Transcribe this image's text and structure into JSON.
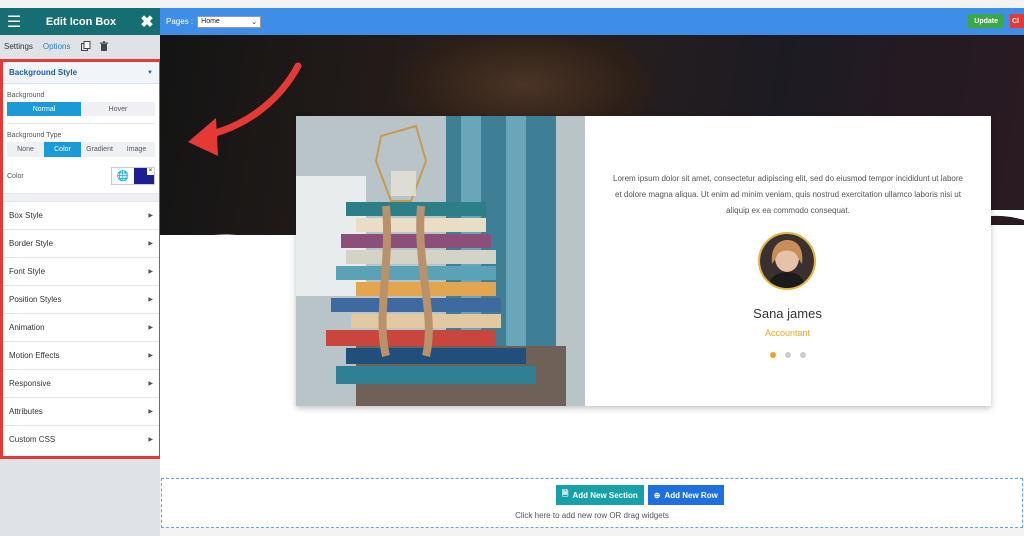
{
  "sidebar": {
    "title": "Edit Icon Box",
    "tabs": {
      "settings": "Settings",
      "options": "Options"
    },
    "section_title": "Background Style",
    "background_label": "Background",
    "state_tabs": [
      "Normal",
      "Hover"
    ],
    "type_label": "Background Type",
    "type_tabs": [
      "None",
      "Color",
      "Gradient",
      "Image"
    ],
    "color_label": "Color",
    "color_value": "#1b1f8f",
    "accordion": [
      "Box Style",
      "Border Style",
      "Font Style",
      "Position Styles",
      "Animation",
      "Motion Effects",
      "Responsive",
      "Attributes",
      "Custom CSS"
    ]
  },
  "topbar": {
    "pages_label": "Pages :",
    "page_select": "Home",
    "update": "Update",
    "red_btn": "Cl"
  },
  "card": {
    "text": "Lorem ipsum dolor sit amet, consectetur adipiscing elit, sed do eiusmod tempor incididunt ut labore et dolore magna aliqua. Ut enim ad minim veniam, quis nostrud exercitation ullamco laboris nisi ut aliquip ex ea commodo consequat.",
    "name": "Sana james",
    "role": "Accountant"
  },
  "add": {
    "section": "Add New Section",
    "row": "Add New Row",
    "hint": "Click here to add new row OR drag widgets"
  },
  "colors": {
    "accent": "#1a9ad6",
    "header": "#166e72",
    "topbar": "#3e8ee8",
    "highlight": "#e53935",
    "role": "#e8a622"
  }
}
